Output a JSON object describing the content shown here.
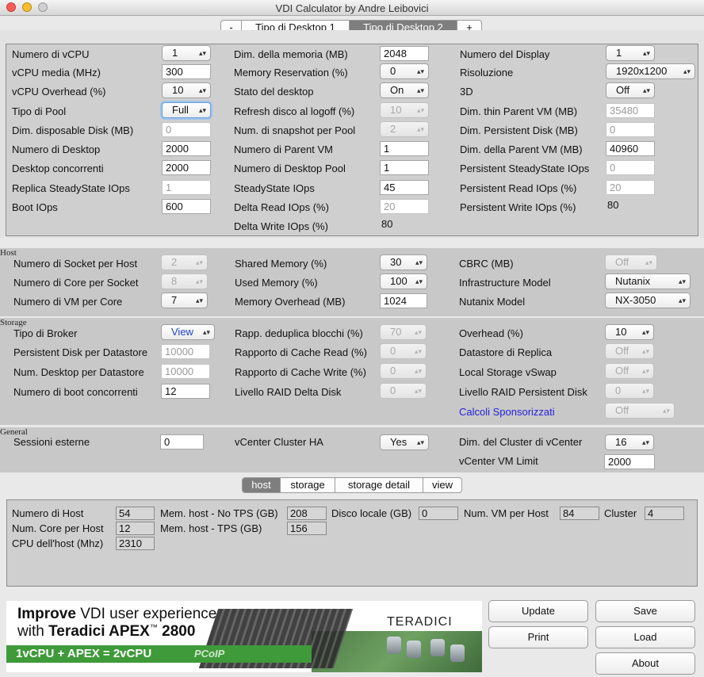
{
  "window": {
    "title": "VDI Calculator by Andre Leibovici"
  },
  "desktop_tabs": [
    "-",
    "Tipo di Desktop 1",
    "Tipo di Desktop 2",
    "+"
  ],
  "desktop": {
    "col1": [
      {
        "label": "Numero di vCPU",
        "value": "1",
        "kind": "popup"
      },
      {
        "label": "vCPU media (MHz)",
        "value": "300",
        "kind": "field"
      },
      {
        "label": "vCPU Overhead (%)",
        "value": "10",
        "kind": "popup"
      },
      {
        "label": "Tipo di Pool",
        "value": "Full",
        "kind": "popup-focus"
      },
      {
        "label": "Dim. disposable Disk (MB)",
        "value": "0",
        "kind": "field-dis"
      },
      {
        "label": "Numero di Desktop",
        "value": "2000",
        "kind": "field"
      },
      {
        "label": "Desktop concorrenti",
        "value": "2000",
        "kind": "field"
      },
      {
        "label": "Replica SteadyState IOps",
        "value": "1",
        "kind": "field-dis"
      },
      {
        "label": "Boot IOps",
        "value": "600",
        "kind": "field"
      }
    ],
    "col2": [
      {
        "label": "Dim. della memoria (MB)",
        "value": "2048",
        "kind": "field"
      },
      {
        "label": "Memory Reservation (%)",
        "value": "0",
        "kind": "popup"
      },
      {
        "label": "Stato del desktop",
        "value": "On",
        "kind": "popup"
      },
      {
        "label": "Refresh disco al logoff (%)",
        "value": "10",
        "kind": "popup-dis"
      },
      {
        "label": "Num. di snapshot per Pool",
        "value": "2",
        "kind": "popup-dis"
      },
      {
        "label": "Numero di Parent VM",
        "value": "1",
        "kind": "field"
      },
      {
        "label": "Numero di Desktop Pool",
        "value": "1",
        "kind": "field"
      },
      {
        "label": "SteadyState IOps",
        "value": "45",
        "kind": "field"
      },
      {
        "label": "Delta Read IOps (%)",
        "value": "20",
        "kind": "field-dis"
      },
      {
        "label": "Delta Write IOps (%)",
        "value": "80",
        "kind": "text"
      }
    ],
    "col3": [
      {
        "label": "Numero del Display",
        "value": "1",
        "kind": "popup"
      },
      {
        "label": "Risoluzione",
        "value": "1920x1200",
        "kind": "popup"
      },
      {
        "label": "3D",
        "value": "Off",
        "kind": "popup"
      },
      {
        "label": "Dim. thin Parent VM (MB)",
        "value": "35480",
        "kind": "field-dis"
      },
      {
        "label": "Dim. Persistent Disk (MB)",
        "value": "0",
        "kind": "field-dis"
      },
      {
        "label": "Dim. della Parent VM (MB)",
        "value": "40960",
        "kind": "field"
      },
      {
        "label": "Persistent SteadyState IOps",
        "value": "0",
        "kind": "field-dis"
      },
      {
        "label": "Persistent Read IOps (%)",
        "value": "20",
        "kind": "field-dis"
      },
      {
        "label": "Persistent Write IOps (%)",
        "value": "80",
        "kind": "text"
      }
    ]
  },
  "host": {
    "section": "Host",
    "col1": [
      {
        "label": "Numero di Socket per Host",
        "value": "2",
        "kind": "popup-dis"
      },
      {
        "label": "Numero di Core per Socket",
        "value": "8",
        "kind": "popup-dis"
      },
      {
        "label": "Numero di VM per Core",
        "value": "7",
        "kind": "popup"
      }
    ],
    "col2": [
      {
        "label": "Shared Memory (%)",
        "value": "30",
        "kind": "popup"
      },
      {
        "label": "Used Memory (%)",
        "value": "100",
        "kind": "popup"
      },
      {
        "label": "Memory Overhead (MB)",
        "value": "1024",
        "kind": "field"
      }
    ],
    "col3": [
      {
        "label": "CBRC (MB)",
        "value": "Off",
        "kind": "popup-dis"
      },
      {
        "label": "Infrastructure Model",
        "value": "Nutanix",
        "kind": "popup"
      },
      {
        "label": "Nutanix Model",
        "value": "NX-3050",
        "kind": "popup"
      }
    ]
  },
  "storage": {
    "section": "Storage",
    "col1": [
      {
        "label": "Tipo di Broker",
        "value": "View",
        "kind": "popup-blue"
      },
      {
        "label": "Persistent Disk per Datastore",
        "value": "10000",
        "kind": "field-dis"
      },
      {
        "label": "Num. Desktop per Datastore",
        "value": "10000",
        "kind": "field-dis"
      },
      {
        "label": "Numero di boot concorrenti",
        "value": "12",
        "kind": "field"
      }
    ],
    "col2": [
      {
        "label": "Rapp. deduplica blocchi (%)",
        "value": "70",
        "kind": "popup-dis"
      },
      {
        "label": "Rapporto di Cache Read (%)",
        "value": "0",
        "kind": "popup-dis"
      },
      {
        "label": "Rapporto di Cache Write (%)",
        "value": "0",
        "kind": "popup-dis"
      },
      {
        "label": "Livello RAID Delta Disk",
        "value": "0",
        "kind": "popup-dis"
      }
    ],
    "col3": [
      {
        "label": "Overhead (%)",
        "value": "10",
        "kind": "popup"
      },
      {
        "label": "Datastore di Replica",
        "value": "Off",
        "kind": "popup-dis"
      },
      {
        "label": "Local Storage vSwap",
        "value": "Off",
        "kind": "popup-dis"
      },
      {
        "label": "Livello RAID Persistent Disk",
        "value": "0",
        "kind": "popup-dis"
      },
      {
        "label": "Calcoli Sponsorizzati",
        "value": "Off",
        "kind": "popup-dis-link"
      }
    ]
  },
  "general": {
    "section": "General",
    "sessioni_label": "Sessioni esterne",
    "sessioni_value": "0",
    "ha_label": "vCenter Cluster HA",
    "ha_value": "Yes",
    "cluster_label": "Dim. del Cluster di vCenter",
    "cluster_value": "16",
    "vmlimit_label": "vCenter VM Limit",
    "vmlimit_value": "2000"
  },
  "result_tabs": [
    "host",
    "storage",
    "storage detail",
    "view"
  ],
  "results": {
    "num_host_label": "Numero di Host",
    "num_host": "54",
    "mem_notps_label": "Mem. host - No TPS (GB)",
    "mem_notps": "208",
    "disco_label": "Disco locale (GB)",
    "disco": "0",
    "vm_host_label": "Num. VM per Host",
    "vm_host": "84",
    "cluster_label": "Cluster",
    "cluster": "4",
    "core_label": "Num. Core per Host",
    "core": "12",
    "mem_tps_label": "Mem. host - TPS (GB)",
    "mem_tps": "156",
    "cpu_label": "CPU dell'host (Mhz)",
    "cpu": "2310"
  },
  "banner": {
    "line1_bold": "Improve",
    "line1_rest": " VDI user experience",
    "line2_pre": "with ",
    "line2_bold": "Teradici APEX",
    "line2_tm": "™",
    "line2_num": " 2800",
    "line3": "1vCPU + APEX = 2vCPU",
    "pcoip": "PCoIP",
    "brand": "TERADICI"
  },
  "buttons": {
    "update": "Update",
    "save": "Save",
    "print": "Print",
    "load": "Load",
    "about": "About"
  }
}
